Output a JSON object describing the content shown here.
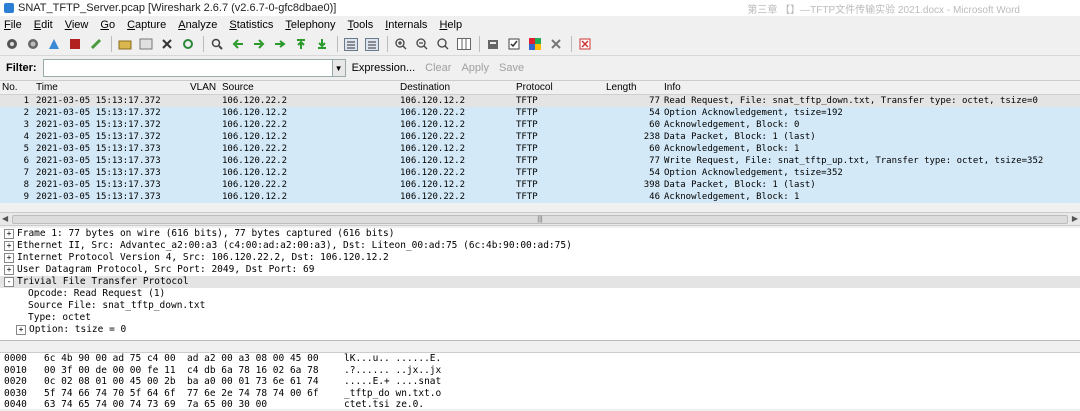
{
  "window": {
    "title": "SNAT_TFTP_Server.pcap [Wireshark 2.6.7 (v2.6.7-0-gfc8dbae0)]",
    "background_text": "第三章 【】—TFTP文件传输实验  2021.docx - Microsoft Word"
  },
  "menu": [
    "File",
    "Edit",
    "View",
    "Go",
    "Capture",
    "Analyze",
    "Statistics",
    "Telephony",
    "Tools",
    "Internals",
    "Help"
  ],
  "filter": {
    "label": "Filter:",
    "value": "",
    "expression": "Expression...",
    "clear": "Clear",
    "apply": "Apply",
    "save": "Save"
  },
  "columns": [
    "No.",
    "Time",
    "VLAN",
    "Source",
    "Destination",
    "Protocol",
    "Length",
    "Info"
  ],
  "packets": [
    {
      "no": "1",
      "time": "2021-03-05 15:13:17.372",
      "vlan": "",
      "src": "106.120.22.2",
      "dst": "106.120.12.2",
      "proto": "TFTP",
      "len": "77",
      "info": "Read Request, File: snat_tftp_down.txt, Transfer type: octet, tsize=0"
    },
    {
      "no": "2",
      "time": "2021-03-05 15:13:17.372",
      "vlan": "",
      "src": "106.120.12.2",
      "dst": "106.120.22.2",
      "proto": "TFTP",
      "len": "54",
      "info": "Option Acknowledgement, tsize=192"
    },
    {
      "no": "3",
      "time": "2021-03-05 15:13:17.372",
      "vlan": "",
      "src": "106.120.22.2",
      "dst": "106.120.12.2",
      "proto": "TFTP",
      "len": "60",
      "info": "Acknowledgement, Block: 0"
    },
    {
      "no": "4",
      "time": "2021-03-05 15:13:17.372",
      "vlan": "",
      "src": "106.120.12.2",
      "dst": "106.120.22.2",
      "proto": "TFTP",
      "len": "238",
      "info": "Data Packet, Block: 1 (last)"
    },
    {
      "no": "5",
      "time": "2021-03-05 15:13:17.373",
      "vlan": "",
      "src": "106.120.22.2",
      "dst": "106.120.12.2",
      "proto": "TFTP",
      "len": "60",
      "info": "Acknowledgement, Block: 1"
    },
    {
      "no": "6",
      "time": "2021-03-05 15:13:17.373",
      "vlan": "",
      "src": "106.120.22.2",
      "dst": "106.120.12.2",
      "proto": "TFTP",
      "len": "77",
      "info": "Write Request, File: snat_tftp_up.txt, Transfer type: octet, tsize=352"
    },
    {
      "no": "7",
      "time": "2021-03-05 15:13:17.373",
      "vlan": "",
      "src": "106.120.12.2",
      "dst": "106.120.22.2",
      "proto": "TFTP",
      "len": "54",
      "info": "Option Acknowledgement, tsize=352"
    },
    {
      "no": "8",
      "time": "2021-03-05 15:13:17.373",
      "vlan": "",
      "src": "106.120.22.2",
      "dst": "106.120.12.2",
      "proto": "TFTP",
      "len": "398",
      "info": "Data Packet, Block: 1 (last)"
    },
    {
      "no": "9",
      "time": "2021-03-05 15:13:17.373",
      "vlan": "",
      "src": "106.120.12.2",
      "dst": "106.120.22.2",
      "proto": "TFTP",
      "len": "46",
      "info": "Acknowledgement, Block: 1"
    }
  ],
  "details": [
    {
      "text": "Frame 1: 77 bytes on wire (616 bits), 77 bytes captured (616 bits)",
      "level": 0,
      "expander": "+"
    },
    {
      "text": "Ethernet II, Src: Advantec_a2:00:a3 (c4:00:ad:a2:00:a3), Dst: Liteon_00:ad:75 (6c:4b:90:00:ad:75)",
      "level": 0,
      "expander": "+"
    },
    {
      "text": "Internet Protocol Version 4, Src: 106.120.22.2, Dst: 106.120.12.2",
      "level": 0,
      "expander": "+"
    },
    {
      "text": "User Datagram Protocol, Src Port: 2049, Dst Port: 69",
      "level": 0,
      "expander": "+"
    },
    {
      "text": "Trivial File Transfer Protocol",
      "level": 0,
      "expander": "-"
    },
    {
      "text": "Opcode: Read Request (1)",
      "level": 1,
      "expander": ""
    },
    {
      "text": "Source File: snat_tftp_down.txt",
      "level": 1,
      "expander": ""
    },
    {
      "text": "Type: octet",
      "level": 1,
      "expander": ""
    },
    {
      "text": "Option: tsize = 0",
      "level": 1,
      "expander": "+"
    }
  ],
  "bytes": [
    {
      "off": "0000",
      "hex": "6c 4b 90 00 ad 75 c4 00  ad a2 00 a3 08 00 45 00",
      "ascii": "lK...u.. ......E."
    },
    {
      "off": "0010",
      "hex": "00 3f 00 de 00 00 fe 11  c4 db 6a 78 16 02 6a 78",
      "ascii": ".?...... ..jx..jx"
    },
    {
      "off": "0020",
      "hex": "0c 02 08 01 00 45 00 2b  ba a0 00 01 73 6e 61 74",
      "ascii": ".....E.+ ....snat"
    },
    {
      "off": "0030",
      "hex": "5f 74 66 74 70 5f 64 6f  77 6e 2e 74 78 74 00 6f",
      "ascii": "_tftp_do wn.txt.o"
    },
    {
      "off": "0040",
      "hex": "63 74 65 74 00 74 73 69  7a 65 00 30 00",
      "ascii": "ctet.tsi ze.0."
    }
  ]
}
